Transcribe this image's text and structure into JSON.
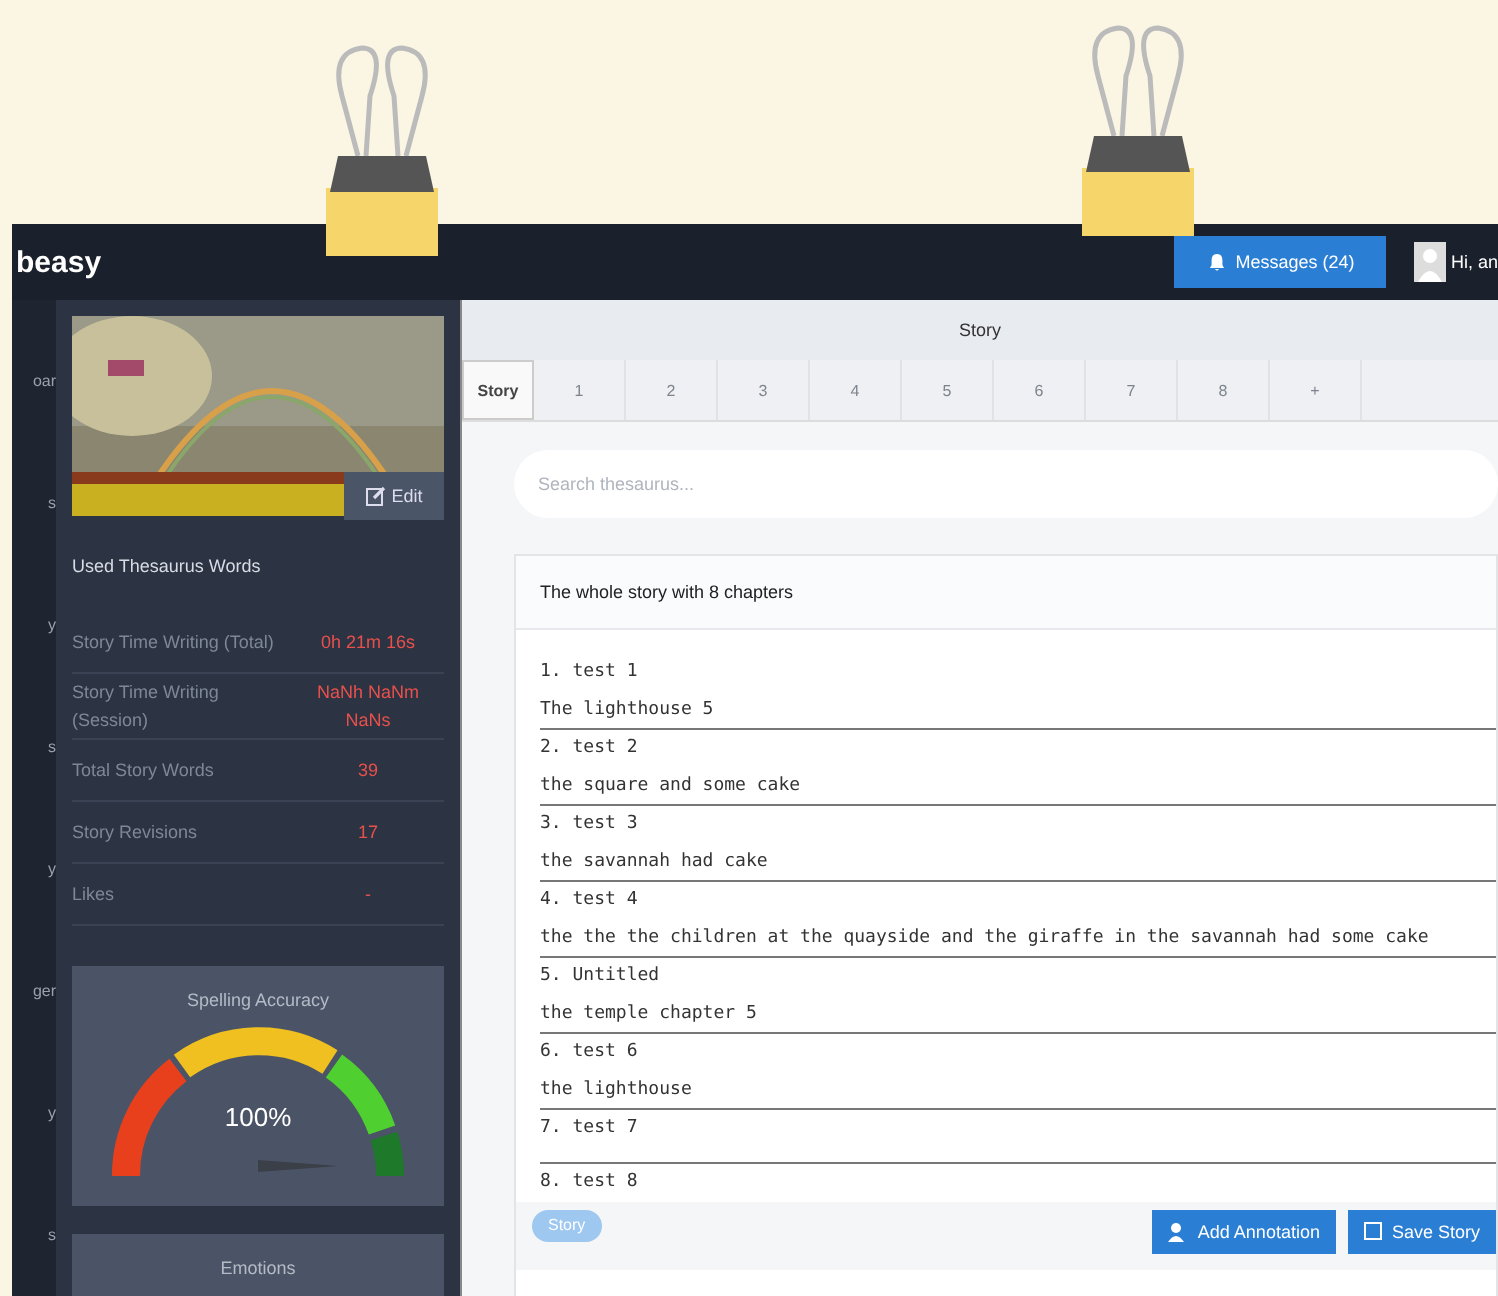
{
  "top_bar": {
    "logo": "beasy",
    "messages_button": "Messages (24)",
    "user_greeting": "Hi, an"
  },
  "nav_items": [
    "oar",
    "s",
    "y",
    "s",
    "y",
    "ger",
    "y",
    "s"
  ],
  "sidebar": {
    "edit_button": "Edit",
    "section_title": "Used Thesaurus Words",
    "stats": [
      {
        "label": "Story Time Writing (Total)",
        "value": "0h 21m 16s"
      },
      {
        "label": "Story Time Writing (Session)",
        "value": "NaNh NaNm NaNs"
      },
      {
        "label": "Total Story Words",
        "value": "39"
      },
      {
        "label": "Story Revisions",
        "value": "17"
      },
      {
        "label": "Likes",
        "value": "-"
      }
    ],
    "spelling_card": {
      "title": "Spelling Accuracy",
      "reading": "100%"
    },
    "emotions_card": {
      "title": "Emotions"
    }
  },
  "main": {
    "header": "Story",
    "tabs": [
      {
        "label": "Story",
        "selected": true
      },
      {
        "label": "1",
        "selected": false
      },
      {
        "label": "2",
        "selected": false
      },
      {
        "label": "3",
        "selected": false
      },
      {
        "label": "4",
        "selected": false
      },
      {
        "label": "5",
        "selected": false
      },
      {
        "label": "6",
        "selected": false
      },
      {
        "label": "7",
        "selected": false
      },
      {
        "label": "8",
        "selected": false
      },
      {
        "label": "+",
        "selected": false
      }
    ],
    "search": {
      "placeholder": "Search thesaurus..."
    },
    "story_card": {
      "title": "The whole story with 8 chapters",
      "chapters": [
        {
          "heading": "1. test 1",
          "text": "The lighthouse 5"
        },
        {
          "heading": "2. test 2",
          "text": "the square and some cake"
        },
        {
          "heading": "3. test 3",
          "text": "the savannah had cake"
        },
        {
          "heading": "4. test 4",
          "text": "the the the children at the quayside and the giraffe in the savannah had some cake"
        },
        {
          "heading": "5. Untitled",
          "text": "the temple chapter 5"
        },
        {
          "heading": "6. test 6",
          "text": "the lighthouse"
        },
        {
          "heading": "7. test 7"
        },
        {
          "heading": "8. test 8"
        }
      ]
    },
    "footer": {
      "back_button": "Story",
      "annotation_button": "Add Annotation",
      "save_button": "Save Story"
    }
  }
}
